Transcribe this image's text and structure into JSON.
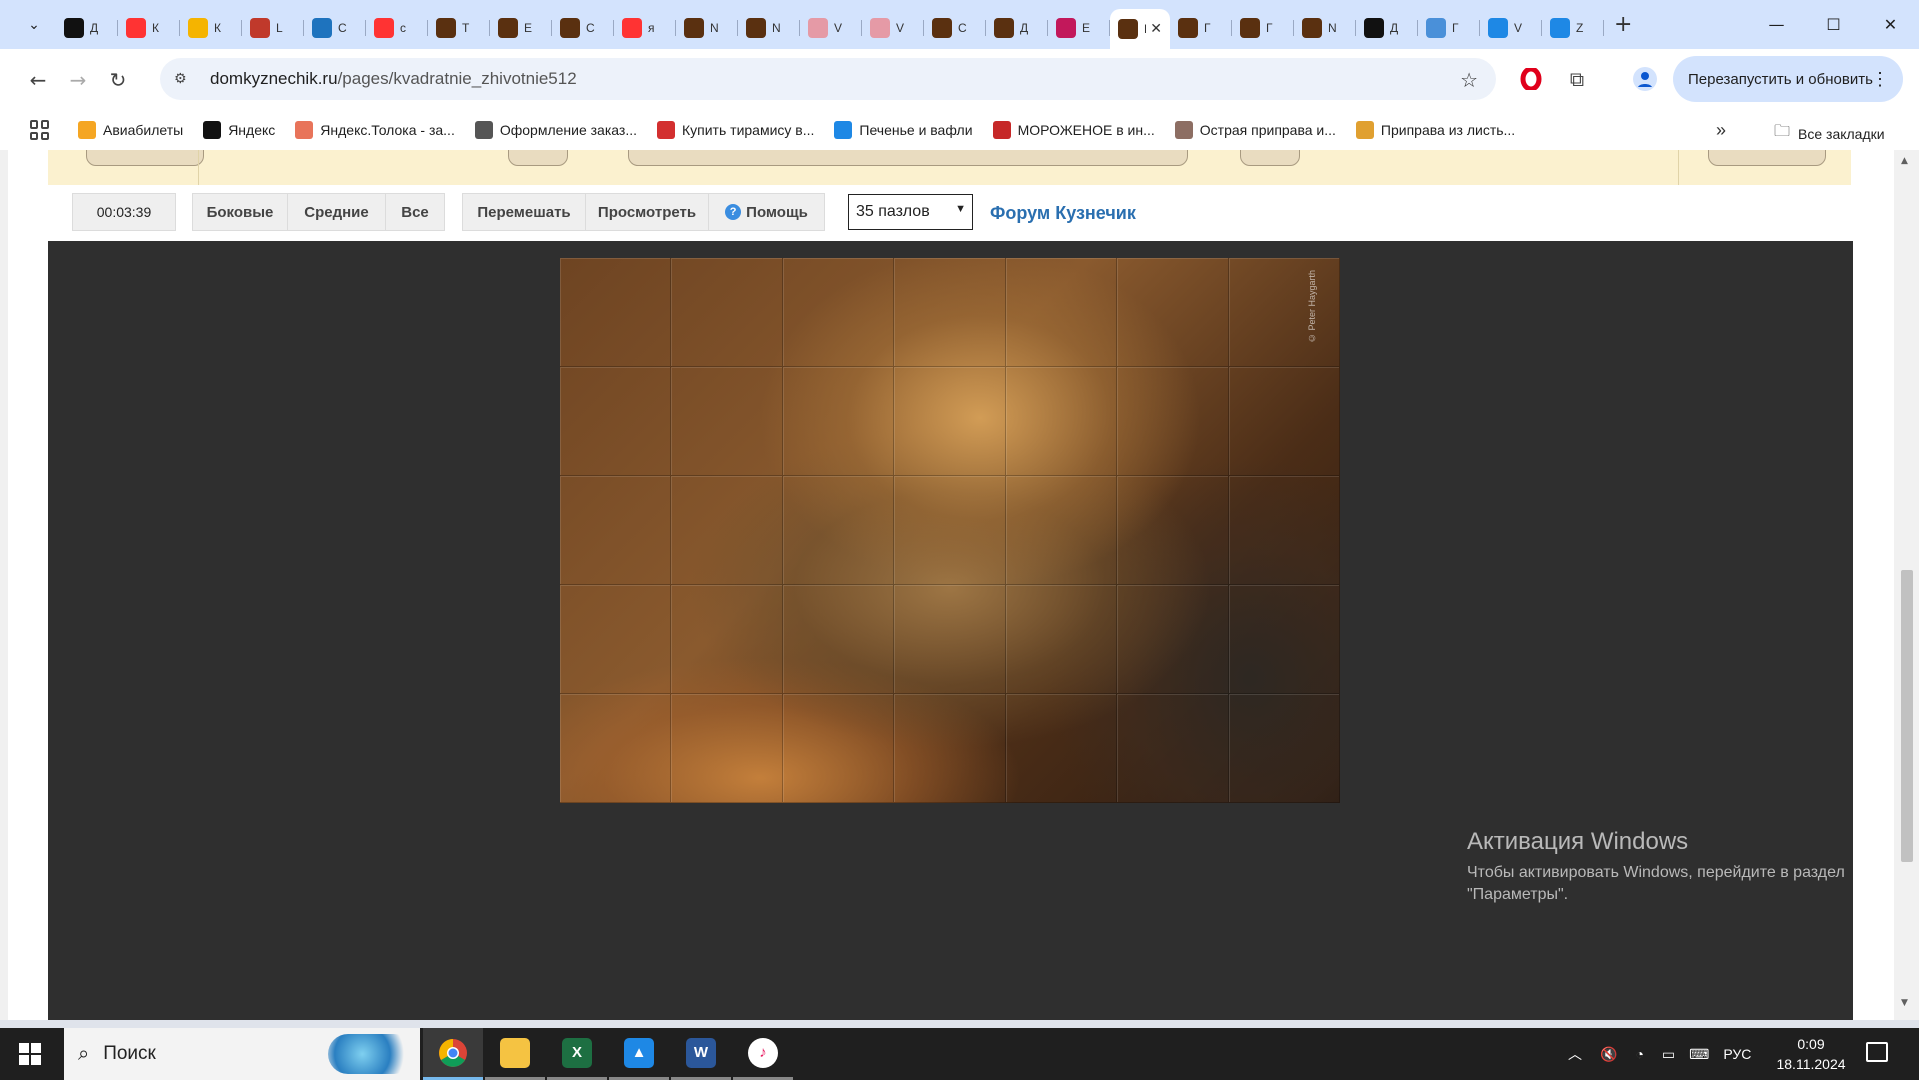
{
  "browser": {
    "tabs": [
      {
        "icon": "plus-circle-icon",
        "title": "Д",
        "color": "#111111"
      },
      {
        "icon": "yandex-icon",
        "title": "К",
        "color": "#f33"
      },
      {
        "icon": "image-icon",
        "title": "К",
        "color": "#f5b400"
      },
      {
        "icon": "red-page-icon",
        "title": "L",
        "color": "#c0392b"
      },
      {
        "icon": "gif-icon",
        "title": "С",
        "color": "#1e73be"
      },
      {
        "icon": "yandex-icon",
        "title": "c",
        "color": "#f33"
      },
      {
        "icon": "puzzle-site-icon",
        "title": "Т",
        "color": "#5a3010"
      },
      {
        "icon": "puzzle-site-icon",
        "title": "Е",
        "color": "#5a3010"
      },
      {
        "icon": "puzzle-site-icon",
        "title": "С",
        "color": "#5a3010"
      },
      {
        "icon": "yandex-icon",
        "title": "я",
        "color": "#f33"
      },
      {
        "icon": "puzzle-site-icon",
        "title": "N",
        "color": "#5a3010"
      },
      {
        "icon": "puzzle-site-icon",
        "title": "N",
        "color": "#5a3010"
      },
      {
        "icon": "cake-icon",
        "title": "V",
        "color": "#e59aa6"
      },
      {
        "icon": "cake-icon",
        "title": "V",
        "color": "#e59aa6"
      },
      {
        "icon": "puzzle-site-icon",
        "title": "С",
        "color": "#5a3010"
      },
      {
        "icon": "puzzle-site-icon",
        "title": "Д",
        "color": "#5a3010"
      },
      {
        "icon": "flower-icon",
        "title": "Е",
        "color": "#c2185b"
      },
      {
        "icon": "puzzle-site-icon",
        "title": "Г",
        "color": "#5a3010",
        "active": true
      },
      {
        "icon": "puzzle-site-icon",
        "title": "Г",
        "color": "#5a3010"
      },
      {
        "icon": "puzzle-site-icon",
        "title": "Г",
        "color": "#5a3010"
      },
      {
        "icon": "puzzle-site-icon",
        "title": "N",
        "color": "#5a3010"
      },
      {
        "icon": "plus-circle-icon",
        "title": "Д",
        "color": "#111111"
      },
      {
        "icon": "boat-icon",
        "title": "Г",
        "color": "#4a90d9"
      },
      {
        "icon": "arrow-icon",
        "title": "V",
        "color": "#1e88e5"
      },
      {
        "icon": "arrow-icon",
        "title": "Z",
        "color": "#1e88e5"
      }
    ],
    "url_host": "domkyznechik.ru",
    "url_path": "/pages/kvadratnie_zhivotnie512",
    "restart_label": "Перезапустить и обновить",
    "bookmarks": [
      {
        "label": "Авиабилеты",
        "color": "#f5a623"
      },
      {
        "label": "Яндекс",
        "color": "#111111"
      },
      {
        "label": "Яндекс.Толока - за...",
        "color": "#e8745a"
      },
      {
        "label": "Оформление заказ...",
        "color": "#555555"
      },
      {
        "label": "Купить тирамису в...",
        "color": "#d32f2f"
      },
      {
        "label": "Печенье и вафли",
        "color": "#1e88e5"
      },
      {
        "label": "МОРОЖЕНОЕ в ин...",
        "color": "#c62828"
      },
      {
        "label": "Острая приправа и...",
        "color": "#8d6e63"
      },
      {
        "label": "Приправа из листь...",
        "color": "#e0a030"
      }
    ],
    "all_bookmarks": "Все закладки"
  },
  "controls": {
    "timer": "00:03:39",
    "edges": "Боковые",
    "middle": "Средние",
    "all": "Все",
    "shuffle": "Перемешать",
    "preview": "Просмотреть",
    "help": "Помощь",
    "pieces_select": "35 пазлов",
    "forum": "Форум Кузнечик"
  },
  "puzzle": {
    "cols": 7,
    "rows": 5,
    "watermark": "© Peter Haygarth"
  },
  "activation": {
    "title": "Активация Windows",
    "line1": "Чтобы активировать Windows, перейдите в раздел",
    "line2": "\"Параметры\"."
  },
  "taskbar": {
    "search_placeholder": "Поиск",
    "apps": [
      {
        "name": "chrome",
        "active": true
      },
      {
        "name": "explorer"
      },
      {
        "name": "excel"
      },
      {
        "name": "photos"
      },
      {
        "name": "word"
      },
      {
        "name": "itunes"
      }
    ],
    "language": "РУС",
    "time": "0:09",
    "date": "18.11.2024"
  }
}
